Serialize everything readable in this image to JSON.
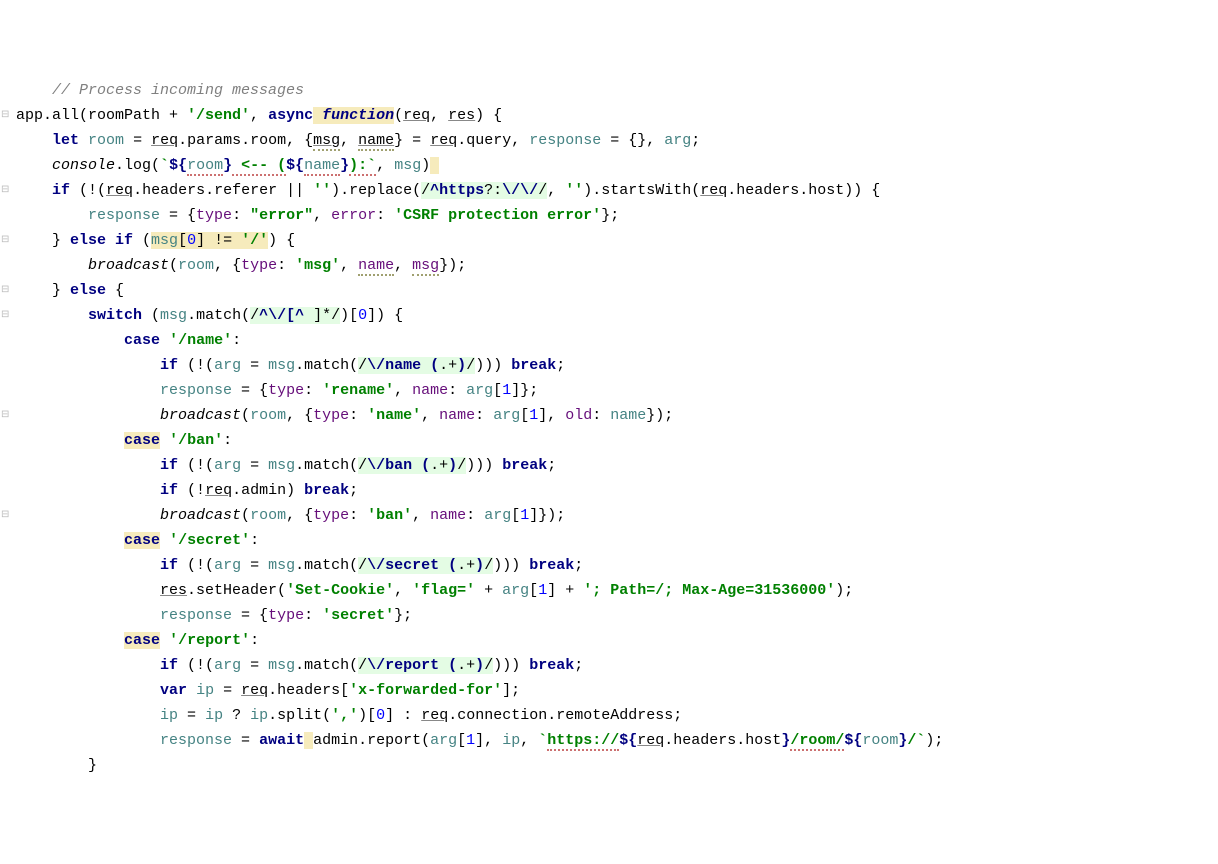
{
  "code": {
    "lines": [
      "    // Process incoming messages",
      "app.all(roomPath + '/send', async function(req, res) {",
      "    let room = req.params.room, {msg, name} = req.query, response = {}, arg;",
      "    console.log(`${room} <-- (${name}):`, msg)",
      "    if (!(req.headers.referer || '').replace(/^https?:\\/\\//, '').startsWith(req.headers.host)) {",
      "        response = {type: \"error\", error: 'CSRF protection error'};",
      "    } else if (msg[0] != '/') {",
      "        broadcast(room, {type: 'msg', name, msg});",
      "    } else {",
      "        switch (msg.match(/^\\/[^ ]*/)[0]) {",
      "            case '/name':",
      "                if (!(arg = msg.match(/\\/name (.+)/))) break;",
      "                response = {type: 'rename', name: arg[1]};",
      "                broadcast(room, {type: 'name', name: arg[1], old: name});",
      "            case '/ban':",
      "                if (!(arg = msg.match(/\\/ban (.+)/))) break;",
      "                if (!req.admin) break;",
      "                broadcast(room, {type: 'ban', name: arg[1]});",
      "            case '/secret':",
      "                if (!(arg = msg.match(/\\/secret (.+)/))) break;",
      "                res.setHeader('Set-Cookie', 'flag=' + arg[1] + '; Path=/; Max-Age=31536000');",
      "                response = {type: 'secret'};",
      "            case '/report':",
      "                if (!(arg = msg.match(/\\/report (.+)/))) break;",
      "                var ip = req.headers['x-forwarded-for'];",
      "                ip = ip ? ip.split(',')[0] : req.connection.remoteAddress;",
      "                response = await admin.report(arg[1], ip, `https://${req.headers.host}/room/${room}/`);",
      "        }"
    ]
  },
  "colors": {
    "keyword": "#000080",
    "string": "#008000",
    "comment": "#808080",
    "number": "#0000ff",
    "highlight": "#f6ebbc",
    "regexhl": "#e4fce4"
  }
}
